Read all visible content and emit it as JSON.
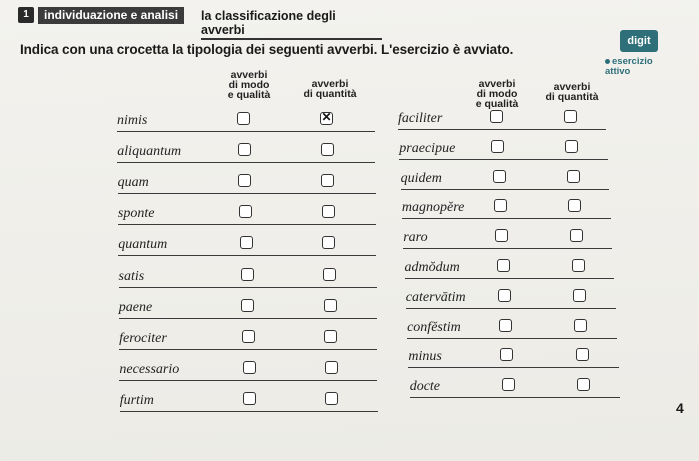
{
  "header": {
    "number": "1",
    "section": "individuazione e analisi",
    "title": "la classificazione degli avverbi"
  },
  "instruction": "Indica con una crocetta la tipologia dei seguenti avverbi. L'esercizio è avviato.",
  "badge": {
    "digit": "digit",
    "esercizio": "esercizio attivo"
  },
  "columns": {
    "col1": [
      "avverbi",
      "di modo",
      "e qualità"
    ],
    "col2": [
      "avverbi",
      "di quantità"
    ]
  },
  "left_words": [
    "nimis",
    "aliquantum",
    "quam",
    "sponte",
    "quantum",
    "satis",
    "paene",
    "ferociter",
    "necessario",
    "furtim"
  ],
  "left_checked": [
    [
      false,
      true
    ],
    [
      false,
      false
    ],
    [
      false,
      false
    ],
    [
      false,
      false
    ],
    [
      false,
      false
    ],
    [
      false,
      false
    ],
    [
      false,
      false
    ],
    [
      false,
      false
    ],
    [
      false,
      false
    ],
    [
      false,
      false
    ]
  ],
  "right_words": [
    "faciliter",
    "praecipue",
    "quidem",
    "magnopĕre",
    "raro",
    "admŏdum",
    "catervātim",
    "confĕstim",
    "minus",
    "docte"
  ],
  "right_checked": [
    [
      false,
      false
    ],
    [
      false,
      false
    ],
    [
      false,
      false
    ],
    [
      false,
      false
    ],
    [
      false,
      false
    ],
    [
      false,
      false
    ],
    [
      false,
      false
    ],
    [
      false,
      false
    ],
    [
      false,
      false
    ],
    [
      false,
      false
    ]
  ],
  "page_number": "4"
}
